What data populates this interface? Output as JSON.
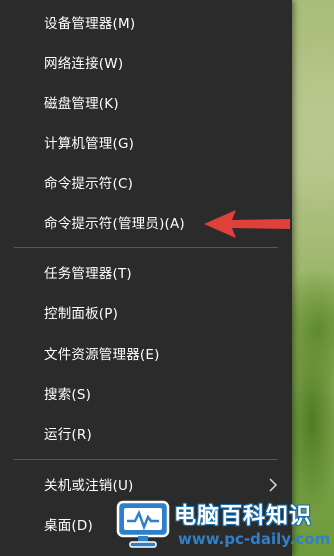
{
  "menu": {
    "items": [
      {
        "label": "设备管理器(M)"
      },
      {
        "label": "网络连接(W)"
      },
      {
        "label": "磁盘管理(K)"
      },
      {
        "label": "计算机管理(G)"
      },
      {
        "label": "命令提示符(C)"
      },
      {
        "label": "命令提示符(管理员)(A)"
      },
      {
        "label": "任务管理器(T)"
      },
      {
        "label": "控制面板(P)"
      },
      {
        "label": "文件资源管理器(E)"
      },
      {
        "label": "搜索(S)"
      },
      {
        "label": "运行(R)"
      },
      {
        "label": "关机或注销(U)"
      },
      {
        "label": "桌面(D)"
      }
    ],
    "submenu_icon": "chevron-right-icon"
  },
  "annotation": {
    "icon": "red-arrow-icon",
    "color": "#e0403a"
  },
  "watermark": {
    "title": "电脑百科知识",
    "url": "www.pc-daily.com",
    "icon": "monitor-logo-icon",
    "accent_color": "#2f80c8"
  },
  "colors": {
    "menu_background": "#2b2b2b",
    "separator": "#575757",
    "text": "#ffffff"
  }
}
